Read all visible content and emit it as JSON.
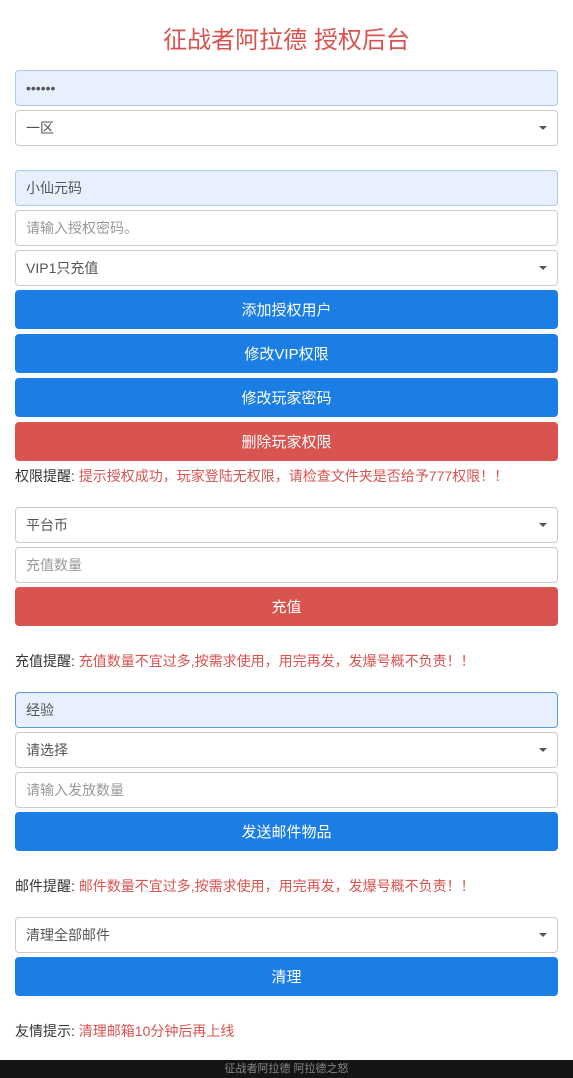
{
  "title": "征战者阿拉德 授权后台",
  "login": {
    "password_value": "••••••",
    "zone_selected": "一区"
  },
  "auth": {
    "code_value": "小仙元码",
    "auth_password_placeholder": "请输入授权密码。",
    "vip_selected": "VIP1只充值",
    "btn_add_user": "添加授权用户",
    "btn_modify_vip": "修改VIP权限",
    "btn_modify_pwd": "修改玩家密码",
    "btn_delete_perm": "删除玩家权限",
    "note_label": "权限提醒: ",
    "note_text": "提示授权成功，玩家登陆无权限，请检查文件夹是否给予777权限！！"
  },
  "recharge": {
    "currency_selected": "平台币",
    "amount_placeholder": "充值数量",
    "btn_recharge": "充值",
    "note_label": "充值提醒: ",
    "note_text": "充值数量不宜过多,按需求使用，用完再发，发爆号概不负责！！"
  },
  "mail": {
    "exp_value": "经验",
    "select_placeholder": "请选择",
    "qty_placeholder": "请输入发放数量",
    "btn_send": "发送邮件物品",
    "note_label": "邮件提醒: ",
    "note_text": "邮件数量不宜过多,按需求使用，用完再发，发爆号概不负责！！"
  },
  "cleanup": {
    "select_value": "清理全部邮件",
    "btn_clean": "清理",
    "note_label": "友情提示: ",
    "note_text": "清理邮箱10分钟后再上线"
  },
  "footer": "征战者阿拉德 阿拉德之怒"
}
